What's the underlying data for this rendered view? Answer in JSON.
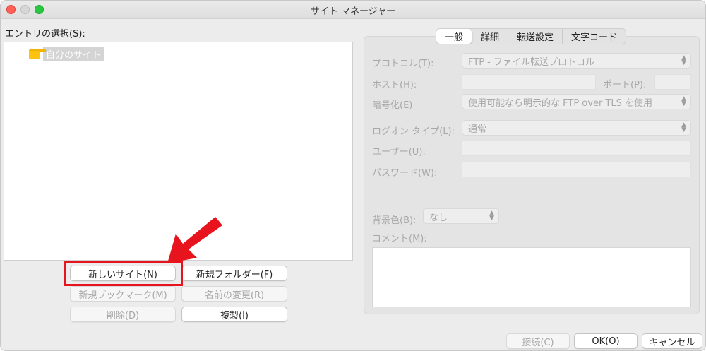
{
  "window": {
    "title": "サイト マネージャー"
  },
  "entries": {
    "label": "エントリの選択(S):",
    "items": [
      {
        "label": "自分のサイト",
        "icon": "folder-icon"
      }
    ]
  },
  "buttons": {
    "new_site": "新しいサイト(N)",
    "new_folder": "新規フォルダー(F)",
    "new_bookmark": "新規ブックマーク(M)",
    "rename": "名前の変更(R)",
    "delete": "削除(D)",
    "duplicate": "複製(I)"
  },
  "tabs": [
    {
      "label": "一般",
      "active": true
    },
    {
      "label": "詳細",
      "active": false
    },
    {
      "label": "転送設定",
      "active": false
    },
    {
      "label": "文字コード",
      "active": false
    }
  ],
  "general": {
    "protocol_label": "プロトコル(T):",
    "protocol_value": "FTP - ファイル転送プロトコル",
    "host_label": "ホスト(H):",
    "host_value": "",
    "port_label": "ポート(P):",
    "port_value": "",
    "encryption_label": "暗号化(E)",
    "encryption_value": "使用可能なら明示的な FTP over TLS を使用",
    "logon_type_label": "ログオン タイプ(L):",
    "logon_type_value": "通常",
    "user_label": "ユーザー(U):",
    "user_value": "",
    "password_label": "パスワード(W):",
    "password_value": "",
    "bgcolor_label": "背景色(B):",
    "bgcolor_value": "なし",
    "comment_label": "コメント(M):",
    "comment_value": ""
  },
  "footer": {
    "connect": "接続(C)",
    "ok": "OK(O)",
    "cancel": "キャンセル"
  },
  "annotation": {
    "highlight_color": "#e8141d"
  }
}
